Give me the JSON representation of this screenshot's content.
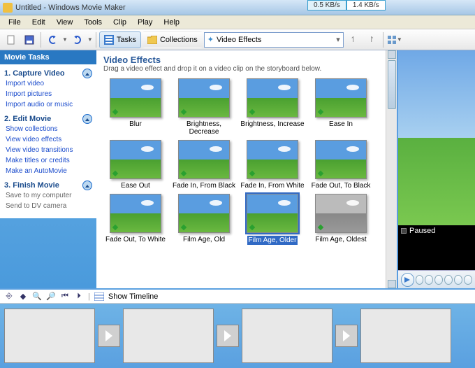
{
  "titlebar": {
    "text": "Untitled - Windows Movie Maker"
  },
  "net": {
    "down": "0.5 KB/s",
    "up": "1.4 KB/s"
  },
  "menu": [
    "File",
    "Edit",
    "View",
    "Tools",
    "Clip",
    "Play",
    "Help"
  ],
  "toolbar": {
    "tasks": "Tasks",
    "collections": "Collections",
    "dropdown": "Video Effects"
  },
  "sidebar": {
    "header": "Movie Tasks",
    "groups": [
      {
        "title": "1. Capture Video",
        "links": [
          "Import video",
          "Import pictures",
          "Import audio or music"
        ]
      },
      {
        "title": "2. Edit Movie",
        "links": [
          "Show collections",
          "View video effects",
          "View video transitions",
          "Make titles or credits",
          "Make an AutoMovie"
        ]
      },
      {
        "title": "3. Finish Movie",
        "links": [
          "Save to my computer",
          "Send to DV camera"
        ],
        "muted": true
      }
    ]
  },
  "content": {
    "heading": "Video Effects",
    "sub": "Drag a video effect and drop it on a video clip on the storyboard below.",
    "effects": [
      "Blur",
      "Brightness, Decrease",
      "Brightness, Increase",
      "Ease In",
      "Ease Out",
      "Fade In, From Black",
      "Fade In, From White",
      "Fade Out, To Black",
      "Fade Out, To White",
      "Film Age, Old",
      "Film Age, Older",
      "Film Age, Oldest"
    ],
    "selected_index": 10
  },
  "preview": {
    "status": "Paused"
  },
  "timeline": {
    "toggle": "Show Timeline"
  }
}
